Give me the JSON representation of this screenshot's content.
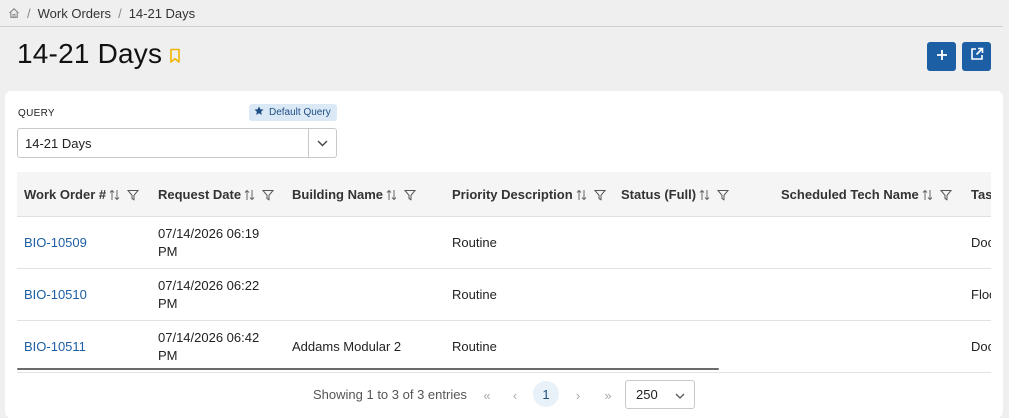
{
  "breadcrumb": {
    "home_icon": "home-icon",
    "items": [
      "Work Orders",
      "14-21 Days"
    ]
  },
  "page": {
    "title": "14-21 Days",
    "bookmark_icon": "bookmark-icon",
    "bookmark_color": "#f0b400",
    "add_icon": "plus-icon",
    "open_icon": "external-link-icon",
    "accent": "#1d5fa4"
  },
  "query": {
    "label": "QUERY",
    "badge": "Default Query",
    "badge_icon": "star-icon",
    "value": "14-21 Days"
  },
  "table": {
    "columns": [
      "Work Order #",
      "Request Date",
      "Building Name",
      "Priority Description",
      "Status (Full)",
      "Scheduled Tech Name",
      "Tas"
    ],
    "rows": [
      {
        "work_order": "BIO-10509",
        "request_date": "07/14/2026 06:19 PM",
        "building": "",
        "priority": "Routine",
        "status": "",
        "tech": "",
        "task": "Doc"
      },
      {
        "work_order": "BIO-10510",
        "request_date": "07/14/2026 06:22 PM",
        "building": "",
        "priority": "Routine",
        "status": "",
        "tech": "",
        "task": "Floo"
      },
      {
        "work_order": "BIO-10511",
        "request_date": "07/14/2026 06:42 PM",
        "building": "Addams Modular 2",
        "priority": "Routine",
        "status": "",
        "tech": "",
        "task": "Doc"
      }
    ]
  },
  "pagination": {
    "info": "Showing 1 to 3 of 3 entries",
    "first": "«",
    "prev": "‹",
    "current_page": "1",
    "next": "›",
    "last": "»",
    "page_size": "250"
  }
}
